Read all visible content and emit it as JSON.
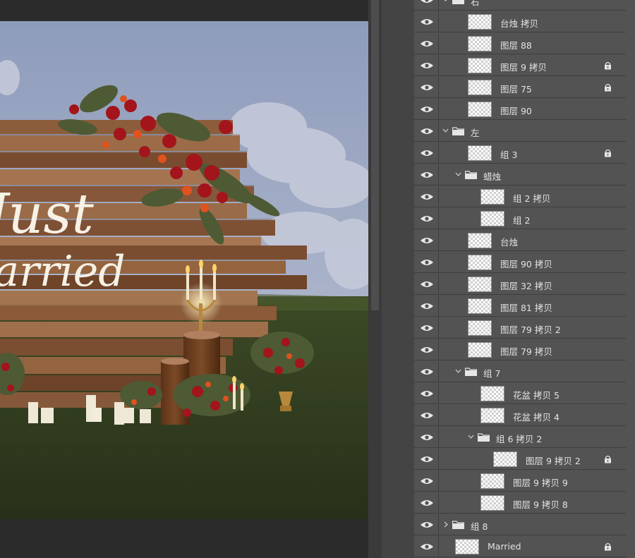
{
  "canvas": {
    "sign_line1": "Just",
    "sign_line2": "Married"
  },
  "layers_panel": {
    "rows": [
      {
        "type": "group",
        "label": "右",
        "indent": 0,
        "expanded": true,
        "locked": false
      },
      {
        "type": "layer",
        "label": "台烛 拷贝",
        "indent": 1,
        "locked": false
      },
      {
        "type": "layer",
        "label": "图层 88",
        "indent": 1,
        "locked": false
      },
      {
        "type": "layer",
        "label": "图层 9 拷贝",
        "indent": 1,
        "locked": true
      },
      {
        "type": "layer",
        "label": "图层 75",
        "indent": 1,
        "locked": true
      },
      {
        "type": "layer",
        "label": "图层 90",
        "indent": 1,
        "locked": false
      },
      {
        "type": "group",
        "label": "左",
        "indent": 0,
        "expanded": true,
        "locked": false
      },
      {
        "type": "layer",
        "label": "组 3",
        "indent": 1,
        "locked": true
      },
      {
        "type": "group",
        "label": "蜡烛",
        "indent": 1,
        "expanded": true,
        "locked": false
      },
      {
        "type": "layer",
        "label": "组 2 拷贝",
        "indent": 2,
        "locked": false
      },
      {
        "type": "layer",
        "label": "组 2",
        "indent": 2,
        "locked": false
      },
      {
        "type": "layer",
        "label": "台烛",
        "indent": 1,
        "locked": false
      },
      {
        "type": "layer",
        "label": "图层 90 拷贝",
        "indent": 1,
        "locked": false
      },
      {
        "type": "layer",
        "label": "图层 32 拷贝",
        "indent": 1,
        "locked": false
      },
      {
        "type": "layer",
        "label": "图层 81 拷贝",
        "indent": 1,
        "locked": false
      },
      {
        "type": "layer",
        "label": "图层 79 拷贝 2",
        "indent": 1,
        "locked": false
      },
      {
        "type": "layer",
        "label": "图层 79 拷贝",
        "indent": 1,
        "locked": false
      },
      {
        "type": "group",
        "label": "组 7",
        "indent": 1,
        "expanded": true,
        "locked": false
      },
      {
        "type": "layer",
        "label": "花盆 拷贝 5",
        "indent": 2,
        "locked": false
      },
      {
        "type": "layer",
        "label": "花盆 拷贝 4",
        "indent": 2,
        "locked": false
      },
      {
        "type": "group",
        "label": "组 6 拷贝 2",
        "indent": 2,
        "expanded": true,
        "locked": false
      },
      {
        "type": "layer",
        "label": "图层 9 拷贝 2",
        "indent": 3,
        "locked": true
      },
      {
        "type": "layer",
        "label": "图层 9 拷贝 9",
        "indent": 2,
        "locked": false
      },
      {
        "type": "layer",
        "label": "图层 9 拷贝 8",
        "indent": 2,
        "locked": false
      },
      {
        "type": "group",
        "label": "组 8",
        "indent": 0,
        "expanded": false,
        "locked": false
      },
      {
        "type": "layer",
        "label": "Married",
        "indent": 0,
        "locked": true
      },
      {
        "type": "layer",
        "label": "",
        "indent": 0,
        "locked": false
      }
    ]
  },
  "colors": {
    "panel_bg": "#535353",
    "row_border": "#3e3e3e",
    "text": "#e2e2e2",
    "sky": "#9aa7c3",
    "grass": "#2f3a1e",
    "wood": "#8a5a3a",
    "flower_red": "#a3141b"
  }
}
